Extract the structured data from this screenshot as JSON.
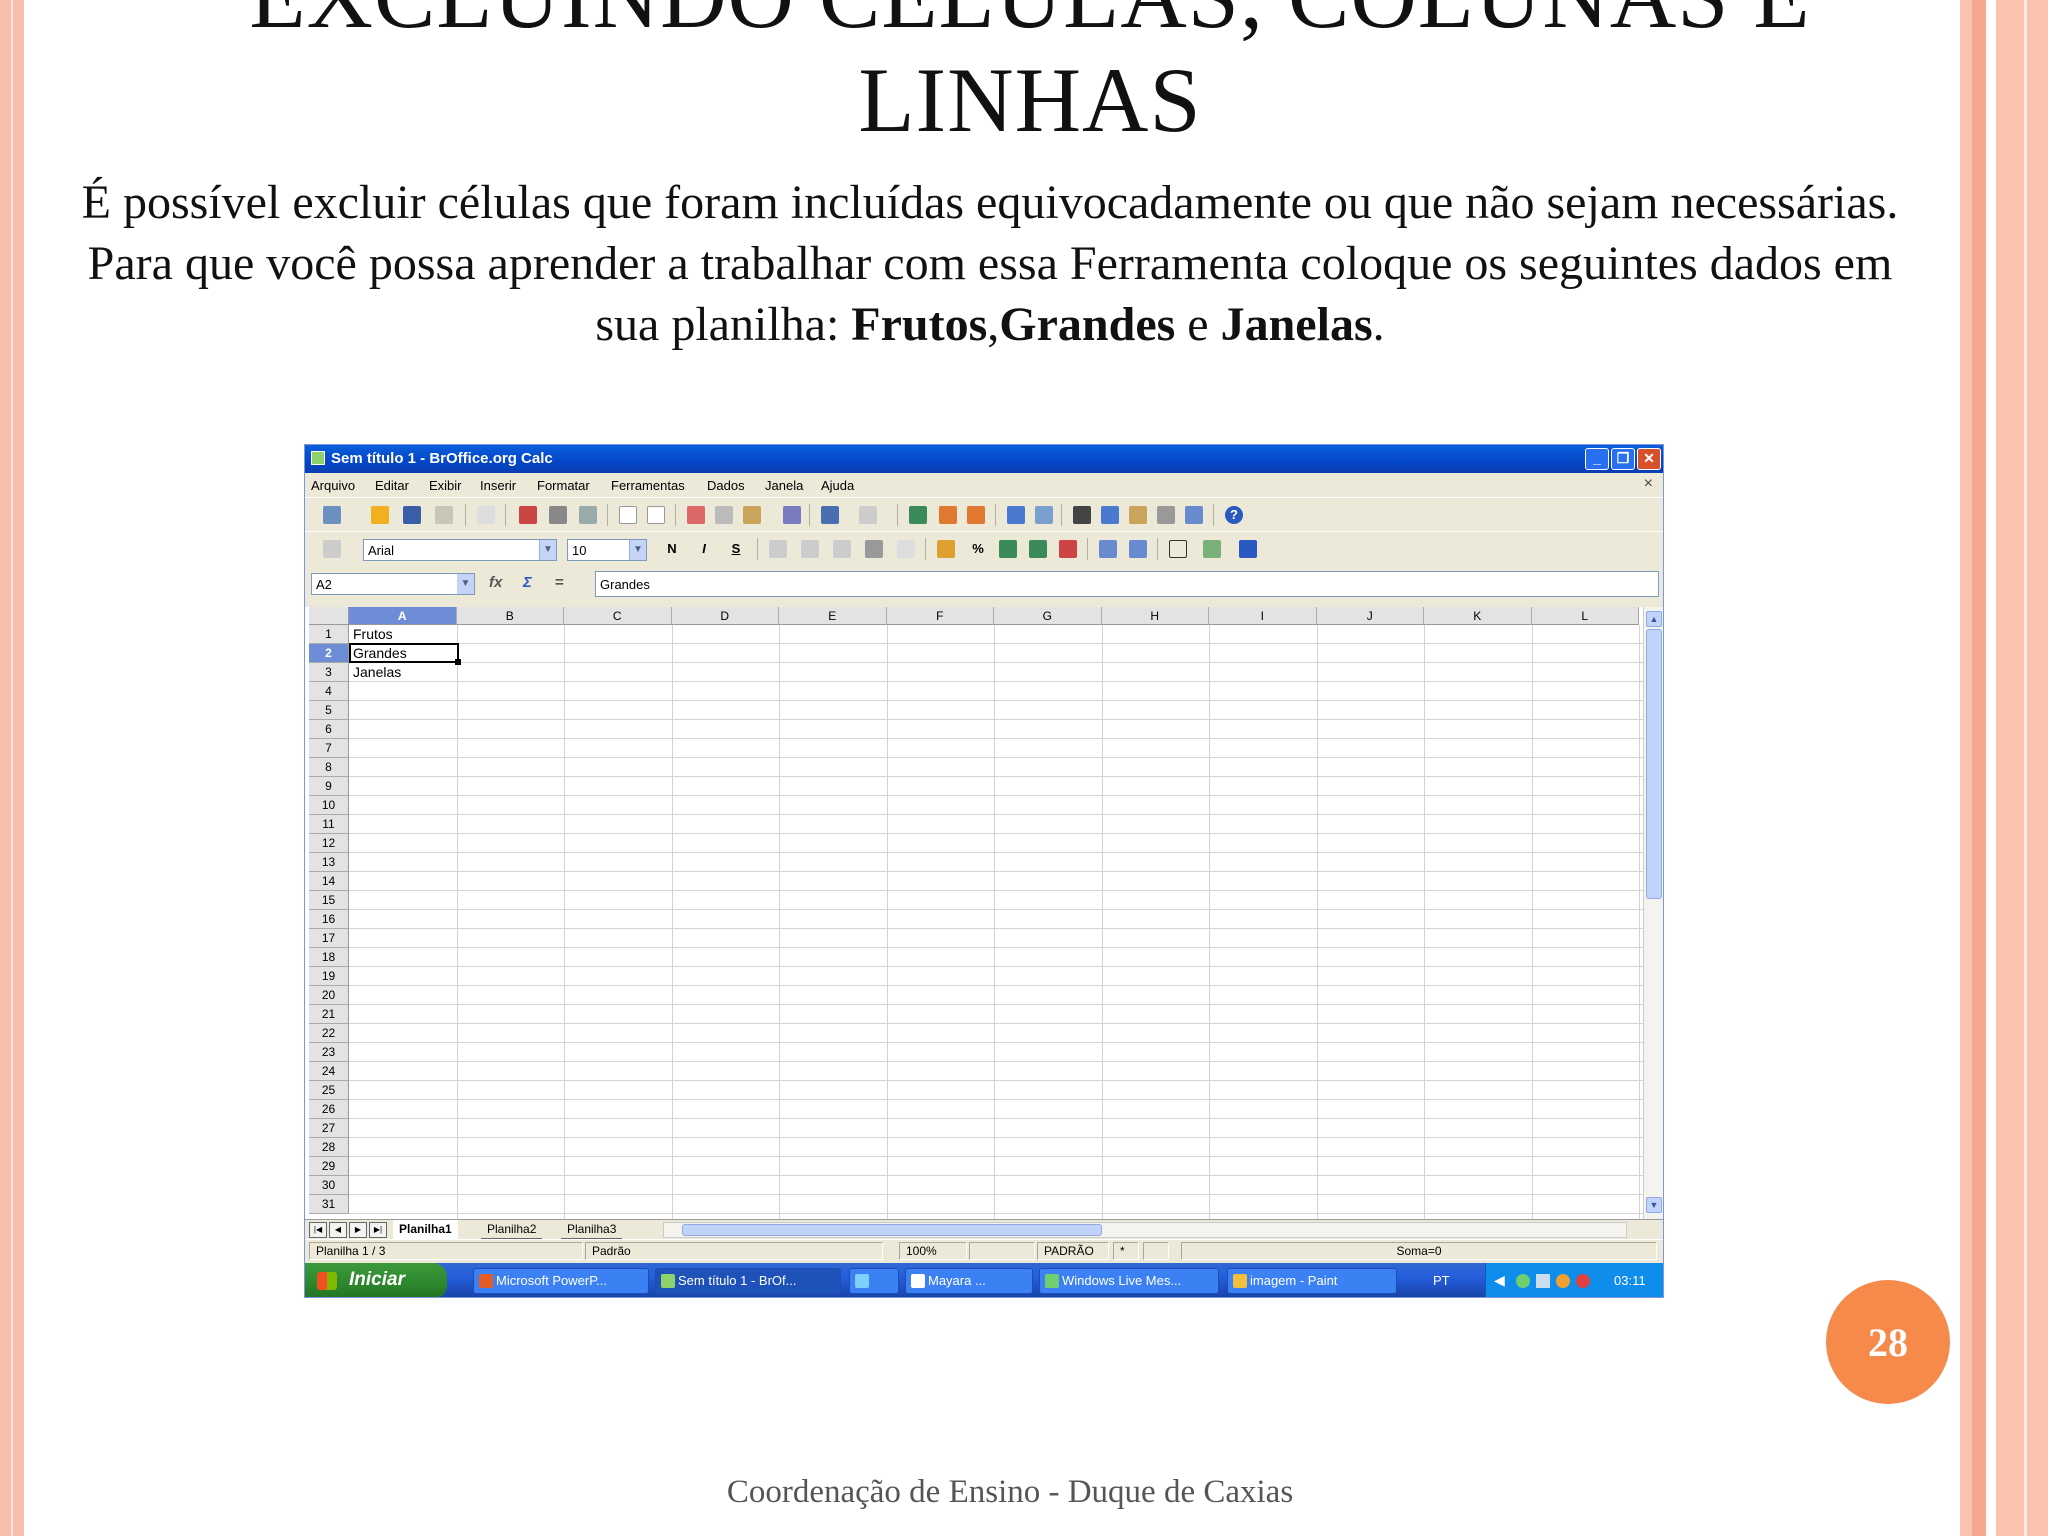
{
  "slide": {
    "title_line1": "EXCLUINDO CÉLULAS, COLUNAS E",
    "title_line2": "LINHAS",
    "body_part1": "É possível excluir células que foram incluídas equivocadamente ou que não sejam necessárias. Para que você possa aprender a trabalhar com essa Ferramenta coloque os seguintes dados em sua planilha: ",
    "bold1": "Frutos",
    "comma": ",",
    "bold2": "Grandes",
    "e": " e ",
    "bold3": "Janelas",
    "period": ".",
    "page_number": "28",
    "footer": "Coordenação de Ensino - Duque de Caxias",
    "colors": {
      "border": "#f8bfae",
      "badge": "#f58a4b"
    }
  },
  "window": {
    "title": "Sem título 1 - BrOffice.org Calc",
    "buttons": {
      "minimize": "_",
      "restore": "❐",
      "close": "✕"
    }
  },
  "menu": [
    "Arquivo",
    "Editar",
    "Exibir",
    "Inserir",
    "Formatar",
    "Ferramentas",
    "Dados",
    "Janela",
    "Ajuda"
  ],
  "toolbar2": {
    "font": "Arial",
    "size": "10",
    "bold": "N",
    "italic": "I",
    "underline": "S"
  },
  "formula": {
    "cell_ref": "A2",
    "content": "Grandes",
    "fx": "fx",
    "sum": "Σ",
    "eq": "="
  },
  "columns": [
    "A",
    "B",
    "C",
    "D",
    "E",
    "F",
    "G",
    "H",
    "I",
    "J",
    "K",
    "L"
  ],
  "rows": [
    "1",
    "2",
    "3",
    "4",
    "5",
    "6",
    "7",
    "8",
    "9",
    "10",
    "11",
    "12",
    "13",
    "14",
    "15",
    "16",
    "17",
    "18",
    "19",
    "20",
    "21",
    "22",
    "23",
    "24",
    "25",
    "26",
    "27",
    "28",
    "29",
    "30",
    "31"
  ],
  "cells": {
    "A1": "Frutos",
    "A2": "Grandes",
    "A3": "Janelas"
  },
  "sheets": [
    "Planilha1",
    "Planilha2",
    "Planilha3"
  ],
  "status": {
    "sheet": "Planilha 1 / 3",
    "style": "Padrão",
    "zoom": "100%",
    "mode": "PADRÃO",
    "modified": "*",
    "sum": "Soma=0"
  },
  "taskbar": {
    "start": "Iniciar",
    "tasks": [
      "Microsoft PowerP...",
      "Sem título 1 - BrOf...",
      "Mayara ...",
      "Windows Live Mes...",
      "imagem - Paint"
    ],
    "lang": "PT",
    "clock": "03:11"
  }
}
